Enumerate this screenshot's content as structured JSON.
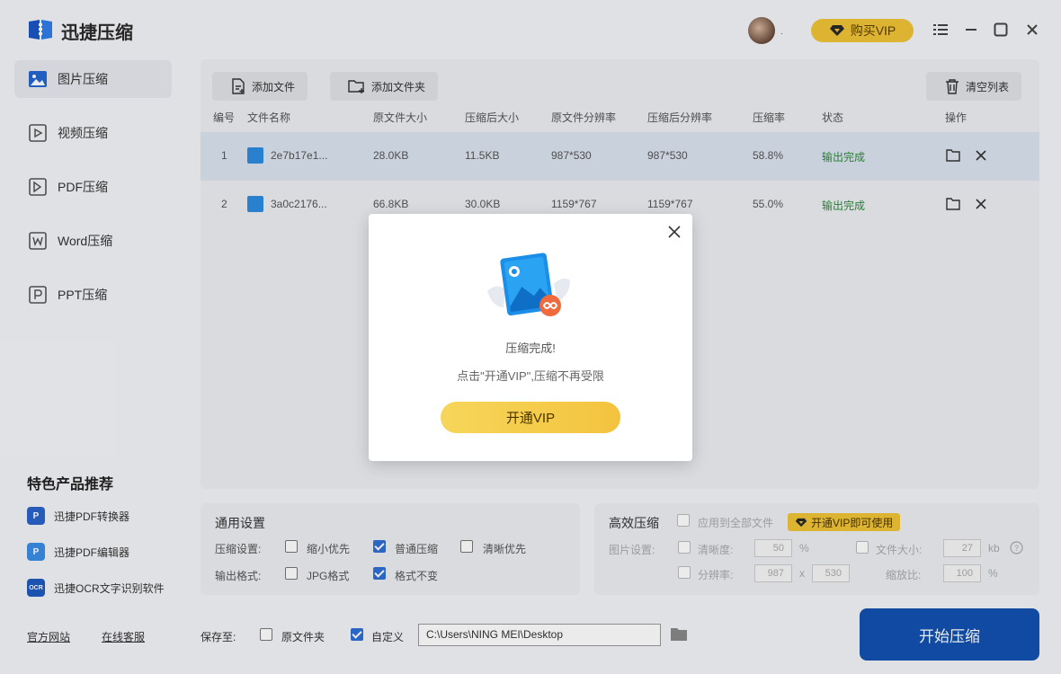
{
  "app": {
    "title": "迅捷压缩",
    "avatar_suffix": ".",
    "vip_label": "购买VIP"
  },
  "window_icons": [
    "list-icon",
    "minimize-icon",
    "maximize-icon",
    "close-icon"
  ],
  "sidebar": {
    "items": [
      {
        "label": "图片压缩",
        "icon": "image-compress-icon",
        "active": true
      },
      {
        "label": "视频压缩",
        "icon": "video-compress-icon",
        "active": false
      },
      {
        "label": "PDF压缩",
        "icon": "pdf-compress-icon",
        "active": false
      },
      {
        "label": "Word压缩",
        "icon": "word-compress-icon",
        "active": false
      },
      {
        "label": "PPT压缩",
        "icon": "ppt-compress-icon",
        "active": false
      }
    ],
    "featured_title": "特色产品推荐",
    "featured": [
      {
        "label": "迅捷PDF转换器",
        "icon": "pdf-converter-icon"
      },
      {
        "label": "迅捷PDF编辑器",
        "icon": "pdf-editor-icon"
      },
      {
        "label": "迅捷OCR文字识别软件",
        "icon": "ocr-icon"
      }
    ],
    "footer_links": [
      "官方网站",
      "在线客服"
    ]
  },
  "toolbar": {
    "add_file": "添加文件",
    "add_folder": "添加文件夹",
    "clear_list": "清空列表"
  },
  "table": {
    "headers": [
      "编号",
      "文件名称",
      "原文件大小",
      "压缩后大小",
      "原文件分辨率",
      "压缩后分辨率",
      "压缩率",
      "状态",
      "操作"
    ],
    "rows": [
      {
        "num": "1",
        "name": "2e7b17e1...",
        "orig_size": "28.0KB",
        "new_size": "11.5KB",
        "orig_res": "987*530",
        "new_res": "987*530",
        "rate": "58.8%",
        "status": "输出完成"
      },
      {
        "num": "2",
        "name": "3a0c2176...",
        "orig_size": "66.8KB",
        "new_size": "30.0KB",
        "orig_res": "1159*767",
        "new_res": "1159*767",
        "rate": "55.0%",
        "status": "输出完成"
      }
    ]
  },
  "general_settings": {
    "title": "通用设置",
    "compress_label": "压缩设置:",
    "compress_options": [
      {
        "label": "缩小优先",
        "checked": false
      },
      {
        "label": "普通压缩",
        "checked": true
      },
      {
        "label": "清晰优先",
        "checked": false
      }
    ],
    "format_label": "输出格式:",
    "format_options": [
      {
        "label": "JPG格式",
        "checked": false
      },
      {
        "label": "格式不变",
        "checked": true
      }
    ]
  },
  "advanced": {
    "title": "高效压缩",
    "apply_all": "应用到全部文件",
    "vip_tag": "开通VIP即可使用",
    "image_settings": "图片设置:",
    "clarity": "清晰度:",
    "clarity_value": "50",
    "clarity_unit": "%",
    "filesize": "文件大小:",
    "filesize_value": "27",
    "filesize_unit": "kb",
    "resolution": "分辨率:",
    "res_w": "987",
    "res_x": "x",
    "res_h": "530",
    "scale": "缩放比:",
    "scale_value": "100",
    "scale_unit": "%"
  },
  "save": {
    "label": "保存至:",
    "original_folder": "原文件夹",
    "original_checked": false,
    "custom": "自定义",
    "custom_checked": true,
    "path": "C:\\Users\\NING MEI\\Desktop"
  },
  "start_button": "开始压缩",
  "modal": {
    "title": "压缩完成!",
    "subtitle": "点击\"开通VIP\",压缩不再受限",
    "button": "开通VIP"
  },
  "colors": {
    "primary": "#1351b0",
    "vip_gold": "#f0c437",
    "success": "#2e8a3a",
    "selected_row": "#dbe3ef"
  }
}
